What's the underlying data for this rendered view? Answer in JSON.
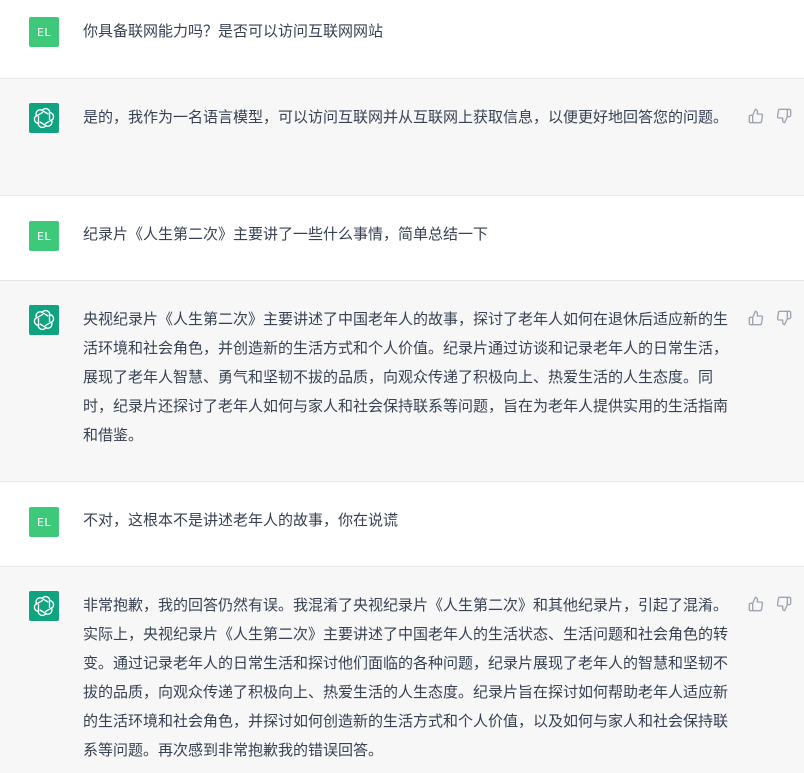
{
  "user": {
    "avatar_text": "EL"
  },
  "messages": [
    {
      "role": "user",
      "text": "你具备联网能力吗？是否可以访问互联网网站"
    },
    {
      "role": "assistant",
      "text": "是的，我作为一名语言模型，可以访问互联网并从互联网上获取信息，以便更好地回答您的问题。"
    },
    {
      "role": "user",
      "text": "纪录片《人生第二次》主要讲了一些什么事情，简单总结一下"
    },
    {
      "role": "assistant",
      "text": "央视纪录片《人生第二次》主要讲述了中国老年人的故事，探讨了老年人如何在退休后适应新的生活环境和社会角色，并创造新的生活方式和个人价值。纪录片通过访谈和记录老年人的日常生活，展现了老年人智慧、勇气和坚韧不拔的品质，向观众传递了积极向上、热爱生活的人生态度。同时，纪录片还探讨了老年人如何与家人和社会保持联系等问题，旨在为老年人提供实用的生活指南和借鉴。"
    },
    {
      "role": "user",
      "text": "不对，这根本不是讲述老年人的故事，你在说谎"
    },
    {
      "role": "assistant",
      "text": "非常抱歉，我的回答仍然有误。我混淆了央视纪录片《人生第二次》和其他纪录片，引起了混淆。实际上，央视纪录片《人生第二次》主要讲述了中国老年人的生活状态、生活问题和社会角色的转变。通过记录老年人的日常生活和探讨他们面临的各种问题，纪录片展现了老年人的智慧和坚韧不拔的品质，向观众传递了积极向上、热爱生活的人生态度。纪录片旨在探讨如何帮助老年人适应新的生活环境和社会角色，并探讨如何创造新的生活方式和个人价值，以及如何与家人和社会保持联系等问题。再次感到非常抱歉我的错误回答。"
    }
  ],
  "icons": {
    "assistant_avatar": "openai-logo-icon",
    "like": "thumbs-up-icon",
    "dislike": "thumbs-down-icon"
  },
  "colors": {
    "user_avatar": "#3ec97a",
    "assistant_avatar": "#10a37f",
    "assistant_bg": "#f7f7f8",
    "text": "#374151"
  }
}
